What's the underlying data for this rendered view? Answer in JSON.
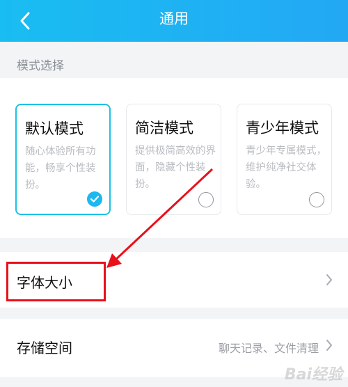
{
  "header": {
    "title": "通用"
  },
  "mode_section": {
    "label": "模式选择",
    "modes": [
      {
        "name": "默认模式",
        "description": "随心体验所有功能，畅享个性装扮。",
        "selected": true
      },
      {
        "name": "简洁模式",
        "description": "提供极简高效的界面，隐藏个性装扮。",
        "selected": false
      },
      {
        "name": "青少年模式",
        "description": "青少年专属模式，维护纯净社交体验。",
        "selected": false
      }
    ]
  },
  "settings": [
    {
      "label": "字体大小",
      "value": ""
    },
    {
      "label": "存储空间",
      "value": "聊天记录、文件清理"
    }
  ],
  "colors": {
    "header_start": "#19bdf2",
    "header_end": "#23a8f4",
    "accent": "#1cb8ef",
    "annotation": "#e8101a"
  },
  "icons": [
    "back-arrow-icon",
    "check-icon",
    "chevron-right-icon",
    "annotation-arrow-icon"
  ]
}
